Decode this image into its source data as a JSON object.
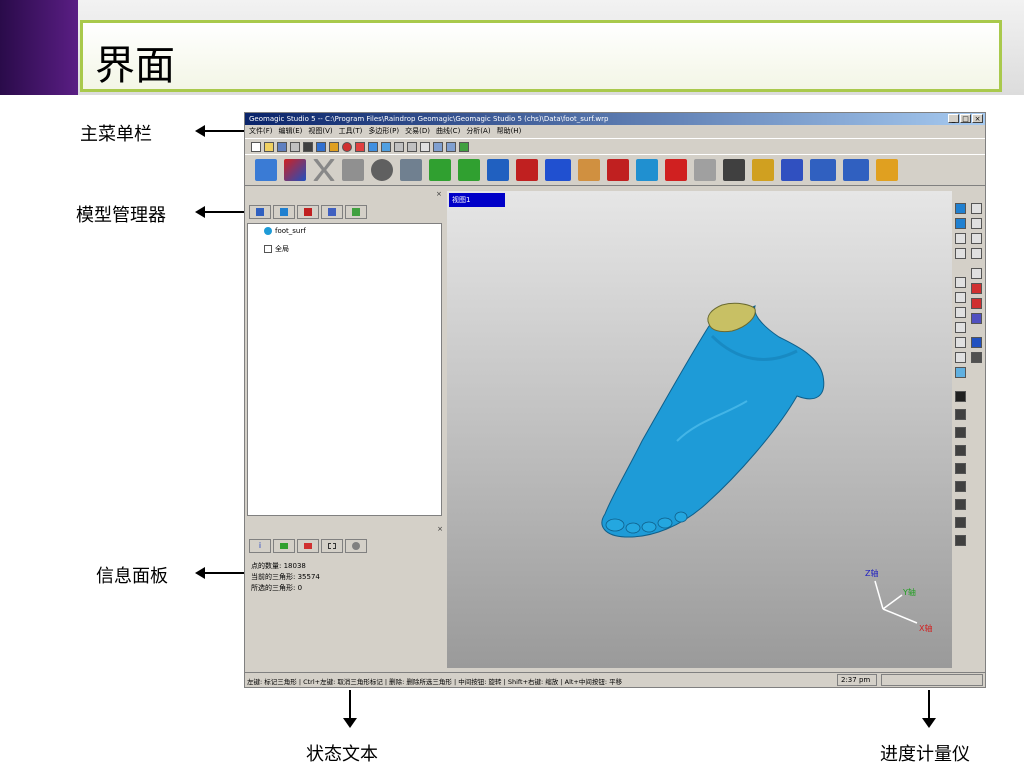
{
  "slide": {
    "title": "界面"
  },
  "annotations": {
    "main_menu": "主菜单栏",
    "model_manager": "模型管理器",
    "info_panel": "信息面板",
    "status_text": "状态文本",
    "progress_meter": "进度计量仪"
  },
  "app": {
    "window_title": "Geomagic Studio 5 -- C:\\Program Files\\Raindrop Geomagic\\Geomagic Studio 5 (chs)\\Data\\foot_surf.wrp",
    "window_buttons": [
      "_",
      "□",
      "×"
    ],
    "menu": [
      "文件(F)",
      "编辑(E)",
      "视图(V)",
      "工具(T)",
      "多边形(P)",
      "交易(D)",
      "曲线(C)",
      "分析(A)",
      "帮助(H)"
    ],
    "model_tree": {
      "items": [
        {
          "label": "foot_surf",
          "icon": "model-icon"
        },
        {
          "label": "全局",
          "icon": "global-icon"
        }
      ]
    },
    "info_panel": {
      "tab_labels": [
        "i",
        "",
        "",
        "",
        ""
      ],
      "lines": [
        "点的数量: 18038",
        "当前的三角形: 35574",
        "所选的三角形: 0"
      ]
    },
    "viewport": {
      "view_label": "视图1",
      "axes": {
        "z": "Z轴",
        "y": "Y轴",
        "x": "X轴"
      }
    },
    "status": {
      "text": "左键: 标记三角形 | Ctrl+左键: 取消三角形标记 | 删除: 删除所选三角形 | 中间按钮: 旋转 | Shift+右键: 缩放 | Alt+中间按钮: 平移",
      "time": "2:37 pm"
    }
  },
  "colors": {
    "accent_green": "#a9c94c",
    "mesh_blue": "#1e9bd7",
    "ankle_yellow": "#c8c064"
  }
}
